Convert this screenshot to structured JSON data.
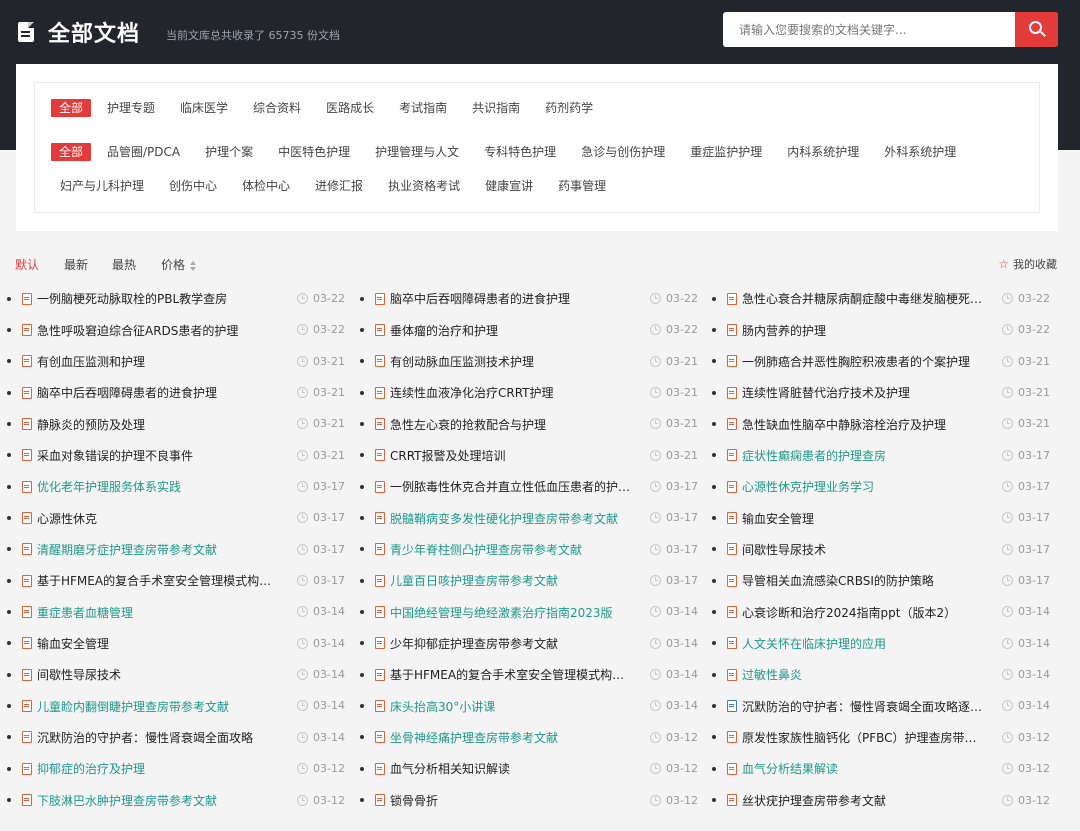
{
  "header": {
    "title": "全部文档",
    "subtitle": "当前文库总共收录了 65735 份文档",
    "search_placeholder": "请输入您要搜索的文档关键字..."
  },
  "filters": {
    "row1": [
      "全部",
      "护理专题",
      "临床医学",
      "综合资料",
      "医路成长",
      "考试指南",
      "共识指南",
      "药剂药学"
    ],
    "row2": [
      "全部",
      "品管圈/PDCA",
      "护理个案",
      "中医特色护理",
      "护理管理与人文",
      "专科特色护理",
      "急诊与创伤护理",
      "重症监护护理",
      "内科系统护理",
      "外科系统护理"
    ],
    "row3": [
      "妇产与儿科护理",
      "创伤中心",
      "体检中心",
      "进修汇报",
      "执业资格考试",
      "健康宣讲",
      "药事管理"
    ]
  },
  "sort": {
    "default": "默认",
    "newest": "最新",
    "hottest": "最热",
    "price": "价格",
    "favorites": "我的收藏"
  },
  "colors": {
    "accent": "#e33a3a",
    "teal_link": "#1e9a8a",
    "header_bg": "#22252c"
  },
  "columns": [
    [
      {
        "title": "一例脑梗死动脉取栓的PBL教学查房",
        "date": "03-22",
        "teal": false,
        "icon": "pdf-icon"
      },
      {
        "title": "急性呼吸窘迫综合征ARDS患者的护理",
        "date": "03-22",
        "teal": false,
        "icon": "pdf-icon"
      },
      {
        "title": "有创血压监测和护理",
        "date": "03-21",
        "teal": false,
        "icon": "pdf-icon"
      },
      {
        "title": "脑卒中后吞咽障碍患者的进食护理",
        "date": "03-21",
        "teal": false,
        "icon": "pdf-icon"
      },
      {
        "title": "静脉炎的预防及处理",
        "date": "03-21",
        "teal": false,
        "icon": "pdf-icon"
      },
      {
        "title": "采血对象错误的护理不良事件",
        "date": "03-21",
        "teal": false,
        "icon": "pdf-icon"
      },
      {
        "title": "优化老年护理服务体系实践",
        "date": "03-17",
        "teal": true,
        "icon": "pdf-icon"
      },
      {
        "title": "心源性休克",
        "date": "03-17",
        "teal": false,
        "icon": "pdf-icon"
      },
      {
        "title": "清醒期磨牙症护理查房带参考文献",
        "date": "03-17",
        "teal": true,
        "icon": "pdf-icon"
      },
      {
        "title": "基于HFMEA的复合手术室安全管理模式构建与应用",
        "date": "03-17",
        "teal": false,
        "icon": "pdf-icon"
      },
      {
        "title": "重症患者血糖管理",
        "date": "03-14",
        "teal": true,
        "icon": "pdf-icon"
      },
      {
        "title": "输血安全管理",
        "date": "03-14",
        "teal": false,
        "icon": "pdf-icon"
      },
      {
        "title": "间歇性导尿技术",
        "date": "03-14",
        "teal": false,
        "icon": "pdf-icon"
      },
      {
        "title": "儿童睑内翻倒睫护理查房带参考文献",
        "date": "03-14",
        "teal": true,
        "icon": "pdf-icon"
      },
      {
        "title": "沉默防治的守护者：慢性肾衰竭全面攻略",
        "date": "03-14",
        "teal": false,
        "icon": "pdf-icon"
      },
      {
        "title": "抑郁症的治疗及护理",
        "date": "03-12",
        "teal": true,
        "icon": "pdf-icon"
      },
      {
        "title": "下肢淋巴水肿护理查房带参考文献",
        "date": "03-12",
        "teal": true,
        "icon": "pdf-icon"
      }
    ],
    [
      {
        "title": "脑卒中后吞咽障碍患者的进食护理",
        "date": "03-22",
        "teal": false,
        "icon": "pdf-icon"
      },
      {
        "title": "垂体瘤的治疗和护理",
        "date": "03-22",
        "teal": false,
        "icon": "pdf-icon"
      },
      {
        "title": "有创动脉血压监测技术护理",
        "date": "03-21",
        "teal": false,
        "icon": "pdf-icon"
      },
      {
        "title": "连续性血液净化治疗CRRT护理",
        "date": "03-21",
        "teal": false,
        "icon": "pdf-icon"
      },
      {
        "title": "急性左心衰的抢救配合与护理",
        "date": "03-21",
        "teal": false,
        "icon": "pdf-icon"
      },
      {
        "title": "CRRT报警及处理培训",
        "date": "03-21",
        "teal": false,
        "icon": "pdf-icon"
      },
      {
        "title": "一例脓毒性休克合并直立性低血压患者的护理查房",
        "date": "03-17",
        "teal": false,
        "icon": "pdf-icon"
      },
      {
        "title": "脱髓鞘病变多发性硬化护理查房带参考文献",
        "date": "03-17",
        "teal": true,
        "icon": "pdf-icon"
      },
      {
        "title": "青少年脊柱侧凸护理查房带参考文献",
        "date": "03-17",
        "teal": true,
        "icon": "pdf-icon"
      },
      {
        "title": "儿童百日咳护理查房带参考文献",
        "date": "03-17",
        "teal": true,
        "icon": "pdf-icon"
      },
      {
        "title": "中国绝经管理与绝经激素治疗指南2023版",
        "date": "03-14",
        "teal": true,
        "icon": "pdf-icon"
      },
      {
        "title": "少年抑郁症护理查房带参考文献",
        "date": "03-14",
        "teal": false,
        "icon": "pdf-icon"
      },
      {
        "title": "基于HFMEA的复合手术室安全管理模式构建与应用",
        "date": "03-14",
        "teal": false,
        "icon": "pdf-icon"
      },
      {
        "title": "床头抬高30°小讲课",
        "date": "03-14",
        "teal": true,
        "icon": "pdf-icon"
      },
      {
        "title": "坐骨神经痛护理查房带参考文献",
        "date": "03-12",
        "teal": true,
        "icon": "pdf-icon"
      },
      {
        "title": "血气分析相关知识解读",
        "date": "03-12",
        "teal": false,
        "icon": "pdf-icon"
      },
      {
        "title": "锁骨骨折",
        "date": "03-12",
        "teal": false,
        "icon": "pdf-icon"
      }
    ],
    [
      {
        "title": "急性心衰合并糖尿病酮症酸中毒继发脑梗死患者的护理",
        "date": "03-22",
        "teal": false,
        "icon": "pdf-icon"
      },
      {
        "title": "肠内营养的护理",
        "date": "03-22",
        "teal": false,
        "icon": "pdf-icon"
      },
      {
        "title": "一例肺癌合并恶性胸腔积液患者的个案护理",
        "date": "03-21",
        "teal": false,
        "icon": "pdf-icon"
      },
      {
        "title": "连续性肾脏替代治疗技术及护理",
        "date": "03-21",
        "teal": false,
        "icon": "pdf-icon"
      },
      {
        "title": "急性缺血性脑卒中静脉溶栓治疗及护理",
        "date": "03-21",
        "teal": false,
        "icon": "pdf-icon"
      },
      {
        "title": "症状性癫痫患者的护理查房",
        "date": "03-17",
        "teal": true,
        "icon": "pdf-icon"
      },
      {
        "title": "心源性休克护理业务学习",
        "date": "03-17",
        "teal": true,
        "icon": "pdf-icon"
      },
      {
        "title": "输血安全管理",
        "date": "03-17",
        "teal": false,
        "icon": "pdf-icon"
      },
      {
        "title": "间歇性导尿技术",
        "date": "03-17",
        "teal": false,
        "icon": "pdf-icon"
      },
      {
        "title": "导管相关血流感染CRBSI的防护策略",
        "date": "03-17",
        "teal": false,
        "icon": "pdf-icon"
      },
      {
        "title": "心衰诊断和治疗2024指南ppt（版本2）",
        "date": "03-14",
        "teal": false,
        "icon": "pdf-icon"
      },
      {
        "title": "人文关怀在临床护理的应用",
        "date": "03-14",
        "teal": true,
        "icon": "pdf-icon"
      },
      {
        "title": "过敏性鼻炎",
        "date": "03-14",
        "teal": true,
        "icon": "pdf-icon"
      },
      {
        "title": "沉默防治的守护者：慢性肾衰竭全面攻略逐页讲解",
        "date": "03-14",
        "teal": false,
        "icon": "word-icon"
      },
      {
        "title": "原发性家族性脑钙化（PFBC）护理查房带参考文献",
        "date": "03-12",
        "teal": false,
        "icon": "pdf-icon"
      },
      {
        "title": "血气分析结果解读",
        "date": "03-12",
        "teal": true,
        "icon": "pdf-icon"
      },
      {
        "title": "丝状疣护理查房带参考文献",
        "date": "03-12",
        "teal": false,
        "icon": "pdf-icon"
      }
    ]
  ]
}
